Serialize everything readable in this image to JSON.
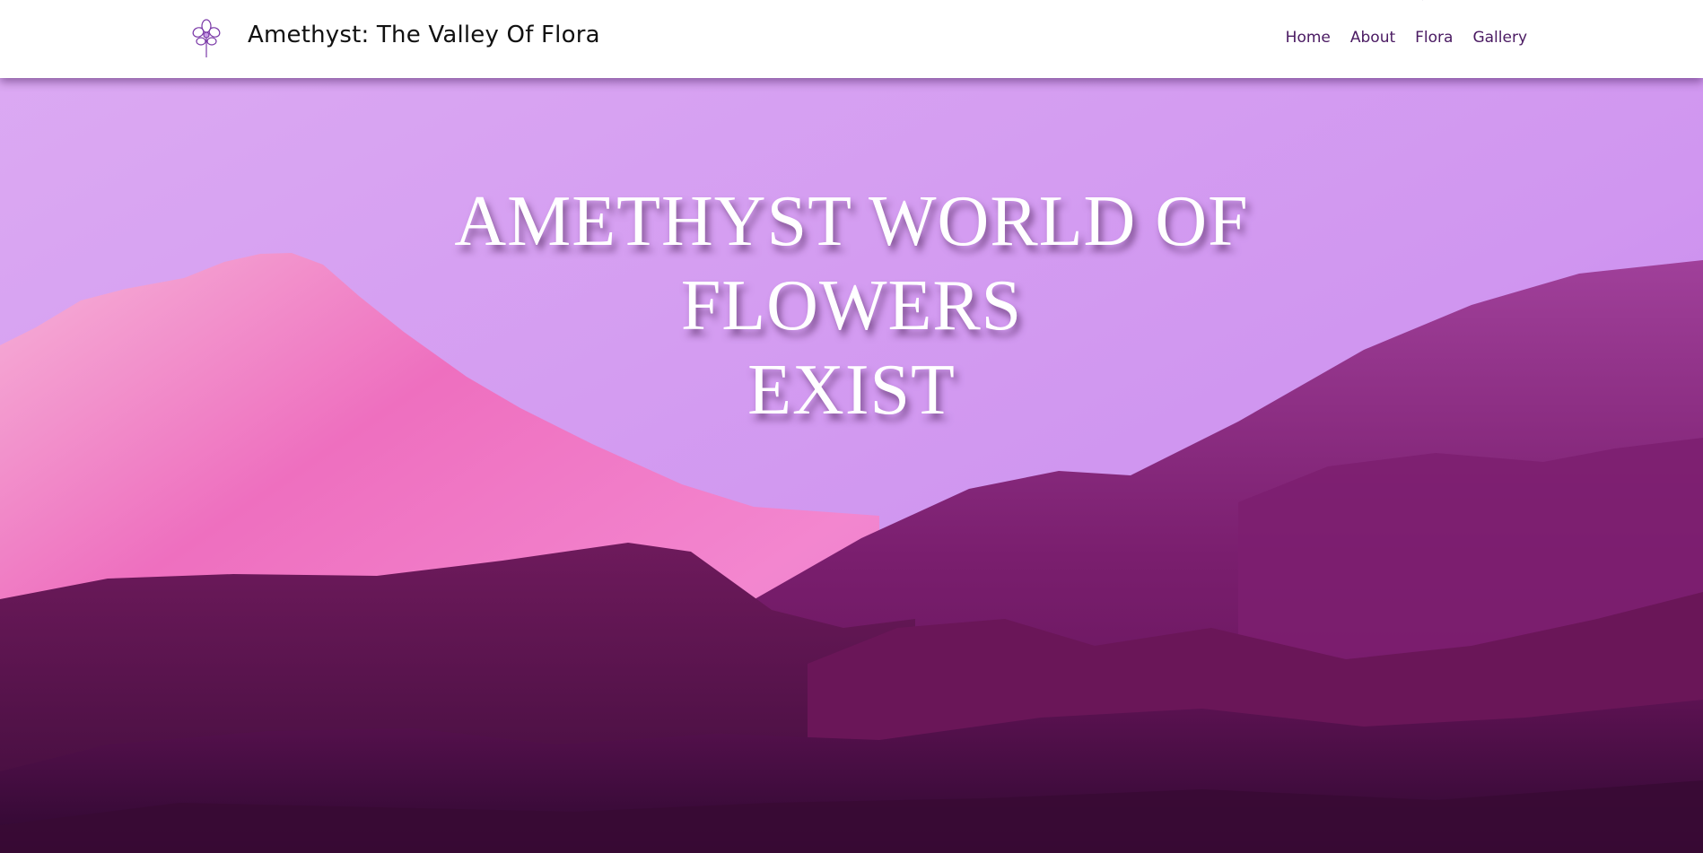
{
  "header": {
    "logo_icon": "orchid-flower-icon",
    "title": "Amethyst: The Valley Of Flora",
    "nav": [
      {
        "label": "Home"
      },
      {
        "label": "About"
      },
      {
        "label": "Flora"
      },
      {
        "label": "Gallery"
      }
    ]
  },
  "hero": {
    "heading_lines": [
      "AMETHYST WORLD OF",
      "FLOWERS",
      "EXIST"
    ],
    "background": "purple-mountain-landscape-image"
  },
  "colors": {
    "nav_text": "#4a1a62",
    "sky_top": "#dba8f2",
    "sky_bottom": "#c889ee",
    "pink_mountain": "#f078c4",
    "dark_mountain": "#5a1148",
    "heading": "#ffffff"
  }
}
